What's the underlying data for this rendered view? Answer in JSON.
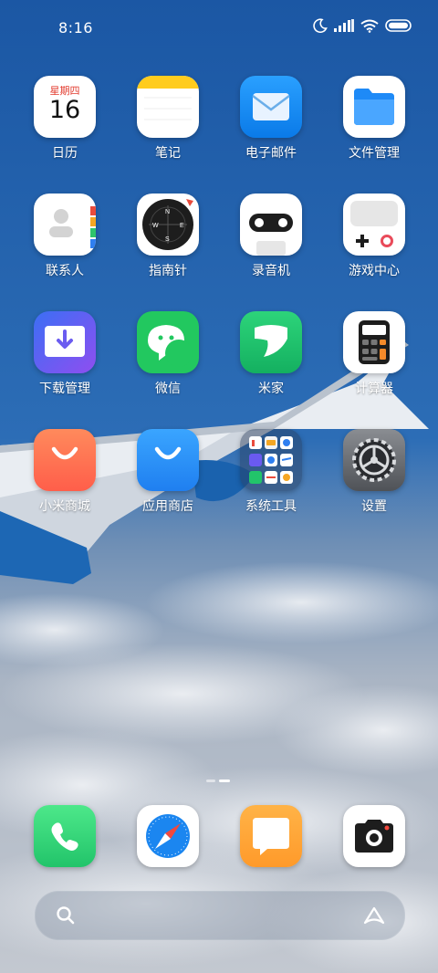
{
  "status_bar": {
    "time": "8:16",
    "icons": [
      "moon-icon",
      "signal-icon",
      "wifi-icon",
      "battery-icon"
    ]
  },
  "apps": {
    "calendar": {
      "label": "日历",
      "day": "星期四",
      "date": "16"
    },
    "notes": {
      "label": "笔记"
    },
    "email": {
      "label": "电子邮件"
    },
    "files": {
      "label": "文件管理"
    },
    "contacts": {
      "label": "联系人"
    },
    "compass": {
      "label": "指南针"
    },
    "recorder": {
      "label": "录音机"
    },
    "game_center": {
      "label": "游戏中心"
    },
    "downloads": {
      "label": "下载管理"
    },
    "wechat": {
      "label": "微信"
    },
    "mi_home": {
      "label": "米家"
    },
    "calculator": {
      "label": "计算器"
    },
    "mi_store": {
      "label": "小米商城"
    },
    "app_store": {
      "label": "应用商店"
    },
    "system_tools": {
      "label": "系统工具"
    },
    "settings": {
      "label": "设置"
    }
  },
  "dock": [
    "phone-icon",
    "browser-icon",
    "messages-icon",
    "camera-icon"
  ],
  "search_bar": {
    "left_icon": "search-icon",
    "right_icon": "assistant-icon"
  },
  "colors": {
    "sky": "#1a5aa8",
    "email": "#1a8cf5",
    "green": "#22c46a",
    "orange": "#ff7a55"
  }
}
